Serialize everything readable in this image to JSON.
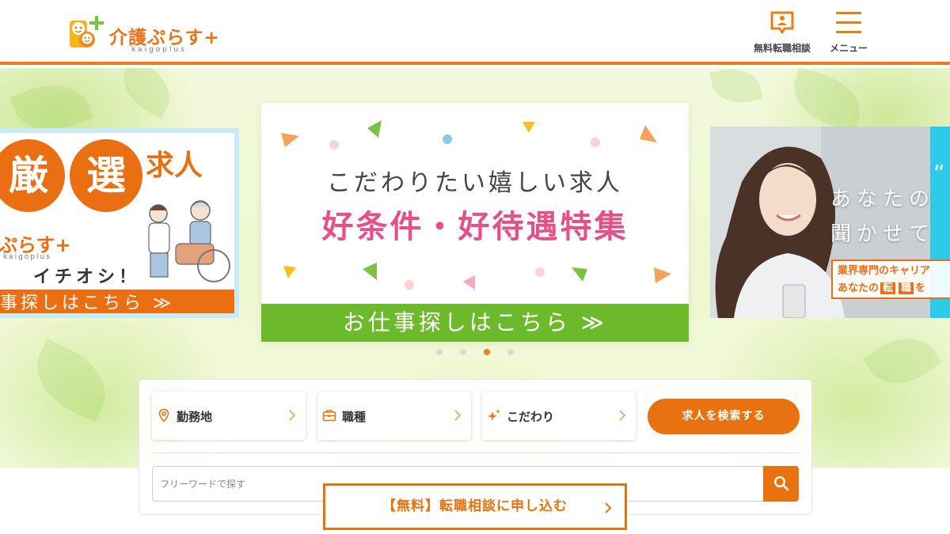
{
  "header": {
    "logo_text": "介護ぷらす+",
    "logo_sub": "kaigoplus",
    "consult_label": "無料転職相談",
    "menu_label": "メニュー",
    "accent_color": "#ef7d15"
  },
  "carousel": {
    "slides": [
      {
        "kanji_1": "厳",
        "kanji_2": "選",
        "title_suffix": "求人",
        "brand": "ぷらす+",
        "brand_sub": "kaigoplus",
        "tagline": "イチオシ！",
        "cta": "事探しはこちら ≫"
      },
      {
        "subtitle": "こだわりたい嬉しい求人",
        "title": "好条件・好待遇特集",
        "cta": "お仕事探しはこちら ≫"
      },
      {
        "line1": "あなたの",
        "line2": "聞かせてく",
        "quote": "“",
        "tag_line1": "業界専門のキャリア",
        "tag_line2_prefix": "あなたの",
        "tag_hl1": "転",
        "tag_hl2": "職",
        "tag_line2_suffix": "を"
      }
    ],
    "dot_count": 4,
    "active_dot": 3
  },
  "search": {
    "filters": [
      {
        "label": "勤務地",
        "icon": "map-pin-icon"
      },
      {
        "label": "職種",
        "icon": "briefcase-icon"
      },
      {
        "label": "こだわり",
        "icon": "sparkle-icon"
      }
    ],
    "search_button": "求人を検索する",
    "freeword_placeholder": "フリーワードで探す",
    "freeword_value": ""
  },
  "consult_button": {
    "label": "【無料】転職相談に申し込む"
  },
  "colors": {
    "orange": "#e8720f",
    "green": "#6cb92c",
    "pink": "#e4508a"
  }
}
